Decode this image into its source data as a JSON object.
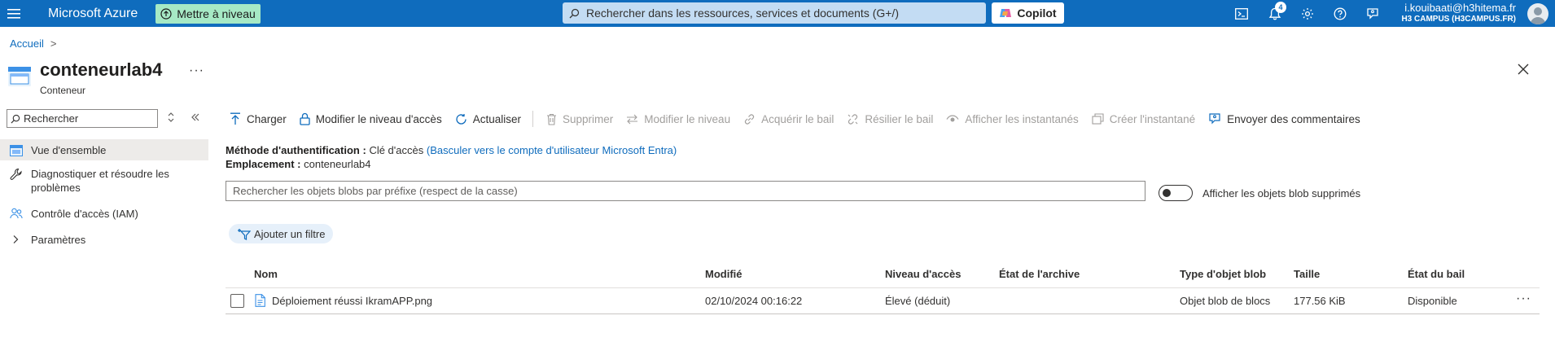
{
  "topbar": {
    "brand": "Microsoft Azure",
    "upgrade_label": "Mettre à niveau",
    "search_placeholder": "Rechercher dans les ressources, services et documents (G+/)",
    "copilot_label": "Copilot",
    "notification_count": "4",
    "account_email": "i.kouibaati@h3hitema.fr",
    "account_org": "H3 CAMPUS (H3CAMPUS.FR)",
    "brand_color": "#0f6cbd"
  },
  "breadcrumb": {
    "home": "Accueil",
    "separator": ">"
  },
  "resource": {
    "title": "conteneurlab4",
    "subtitle": "Conteneur",
    "more": "···"
  },
  "sidebar": {
    "search_placeholder": "Rechercher",
    "items": [
      {
        "label": "Vue d'ensemble",
        "icon": "overview-icon",
        "active": true
      },
      {
        "label": "Diagnostiquer et résoudre les problèmes",
        "icon": "wrench-icon",
        "active": false
      },
      {
        "label": "Contrôle d'accès (IAM)",
        "icon": "people-icon",
        "active": false
      },
      {
        "label": "Paramètres",
        "icon": "chevron-right-icon",
        "active": false
      }
    ]
  },
  "toolbar": {
    "upload": "Charger",
    "change_access_level": "Modifier le niveau d'accès",
    "refresh": "Actualiser",
    "delete": "Supprimer",
    "change_tier": "Modifier le niveau",
    "acquire_lease": "Acquérir le bail",
    "break_lease": "Résilier le bail",
    "view_snapshots": "Afficher les instantanés",
    "create_snapshot": "Créer l'instantané",
    "feedback": "Envoyer des commentaires"
  },
  "info": {
    "auth_label": "Méthode d'authentification :",
    "auth_value": "Clé d'accès",
    "auth_link": "(Basculer vers le compte d'utilisateur Microsoft Entra)",
    "location_label": "Emplacement :",
    "location_value": "conteneurlab4"
  },
  "blob_search": {
    "placeholder": "Rechercher les objets blobs par préfixe (respect de la casse)"
  },
  "show_deleted": {
    "label": "Afficher les objets blob supprimés",
    "checked": false
  },
  "filter": {
    "add_label": "Ajouter un filtre"
  },
  "table": {
    "columns": [
      "Nom",
      "Modifié",
      "Niveau d'accès",
      "État de l'archive",
      "Type d'objet blob",
      "Taille",
      "État du bail"
    ],
    "rows": [
      {
        "name": "Déploiement réussi IkramAPP.png",
        "modified": "02/10/2024 00:16:22",
        "access_tier": "Élevé (déduit)",
        "archive_state": "",
        "blob_type": "Objet blob de blocs",
        "size": "177.56 KiB",
        "lease_state": "Disponible",
        "more": "···"
      }
    ]
  }
}
